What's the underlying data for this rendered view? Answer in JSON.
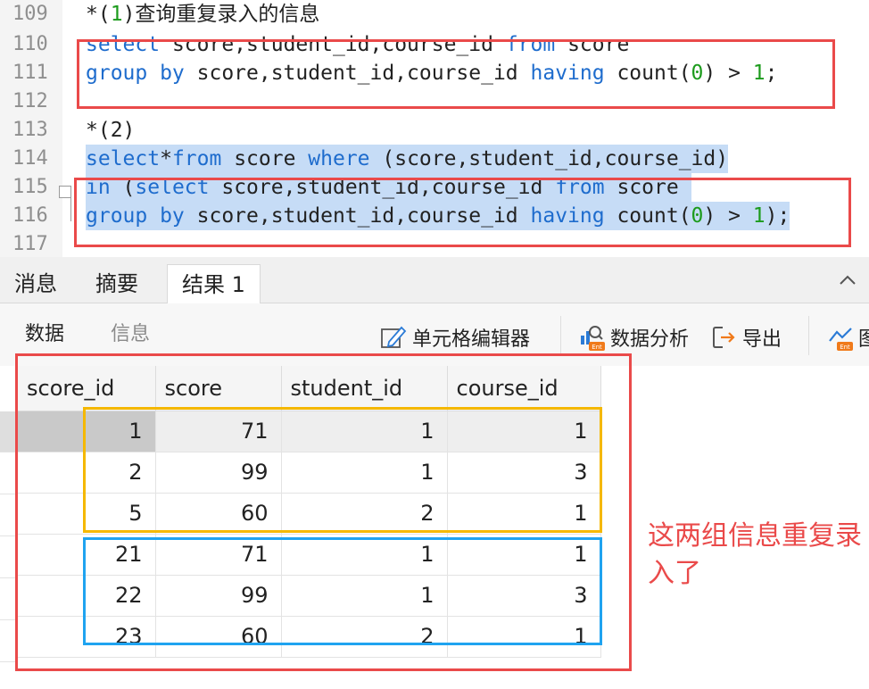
{
  "editor": {
    "lines": [
      {
        "no": "109",
        "tokens": [
          {
            "t": "*(",
            "c": ""
          },
          {
            "t": "1",
            "c": "num"
          },
          {
            "t": ")查询重复录入的信息",
            "c": ""
          }
        ]
      },
      {
        "no": "110",
        "tokens": [
          {
            "t": "select",
            "c": "kw"
          },
          {
            "t": " score,student_id,course_id ",
            "c": ""
          },
          {
            "t": "from",
            "c": "kw"
          },
          {
            "t": " score",
            "c": ""
          }
        ]
      },
      {
        "no": "111",
        "tokens": [
          {
            "t": "group by",
            "c": "kw"
          },
          {
            "t": " score,student_id,course_id ",
            "c": ""
          },
          {
            "t": "having",
            "c": "kw"
          },
          {
            "t": " count(",
            "c": ""
          },
          {
            "t": "0",
            "c": "num"
          },
          {
            "t": ") > ",
            "c": ""
          },
          {
            "t": "1",
            "c": "num"
          },
          {
            "t": ";",
            "c": ""
          }
        ]
      },
      {
        "no": "112",
        "tokens": []
      },
      {
        "no": "113",
        "tokens": [
          {
            "t": "*(2)",
            "c": ""
          }
        ]
      },
      {
        "no": "114",
        "selected": true,
        "tokens": [
          {
            "t": "select",
            "c": "kw"
          },
          {
            "t": "*",
            "c": ""
          },
          {
            "t": "from",
            "c": "kw"
          },
          {
            "t": " score ",
            "c": ""
          },
          {
            "t": "where",
            "c": "kw"
          },
          {
            "t": " (score,student_id,course_id)",
            "c": ""
          }
        ]
      },
      {
        "no": "115",
        "selected": true,
        "tokens": [
          {
            "t": "in",
            "c": "kw"
          },
          {
            "t": " (",
            "c": ""
          },
          {
            "t": "select",
            "c": "kw"
          },
          {
            "t": " score,student_id,course_id ",
            "c": ""
          },
          {
            "t": "from",
            "c": "kw"
          },
          {
            "t": " score ",
            "c": ""
          }
        ]
      },
      {
        "no": "116",
        "selected": true,
        "tokens": [
          {
            "t": "group by",
            "c": "kw"
          },
          {
            "t": " score,student_id,course_id ",
            "c": ""
          },
          {
            "t": "having",
            "c": "kw"
          },
          {
            "t": " count(",
            "c": ""
          },
          {
            "t": "0",
            "c": "num"
          },
          {
            "t": ") > ",
            "c": ""
          },
          {
            "t": "1",
            "c": "num"
          },
          {
            "t": ");",
            "c": ""
          }
        ]
      },
      {
        "no": "117",
        "tokens": []
      }
    ]
  },
  "panel": {
    "tabs": [
      "消息",
      "摘要",
      "结果 1"
    ],
    "active_tab": "结果 1",
    "subtabs": [
      "数据",
      "信息"
    ],
    "tools": {
      "cell_editor": "单元格编辑器",
      "data_analysis": "数据分析",
      "export": "导出",
      "extra": "图"
    },
    "collapse_icon": "chevron-up-icon"
  },
  "grid": {
    "columns": [
      "score_id",
      "score",
      "student_id",
      "course_id"
    ],
    "rows": [
      [
        "1",
        "71",
        "1",
        "1"
      ],
      [
        "2",
        "99",
        "1",
        "3"
      ],
      [
        "5",
        "60",
        "2",
        "1"
      ],
      [
        "21",
        "71",
        "1",
        "1"
      ],
      [
        "22",
        "99",
        "1",
        "3"
      ],
      [
        "23",
        "60",
        "2",
        "1"
      ]
    ]
  },
  "annotation": {
    "note": "这两组信息重复录入了",
    "colors": {
      "red": "#ea4a4a",
      "yellow": "#f5b800",
      "blue": "#1fa3f0"
    }
  },
  "colors": {
    "keyword": "#1e6ccd",
    "number": "#1d9b1d",
    "selection": "#c6dcf6"
  }
}
